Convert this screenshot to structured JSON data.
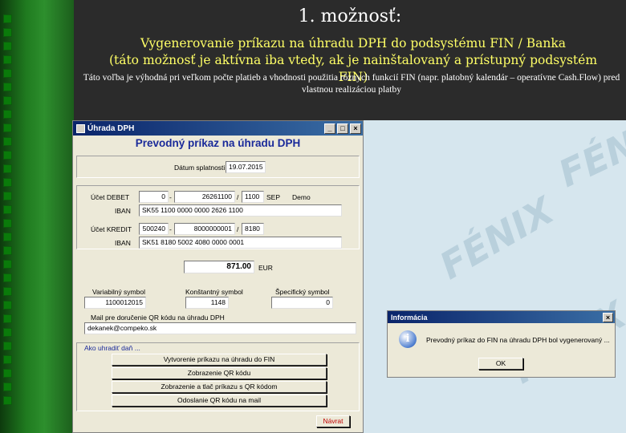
{
  "slide": {
    "title": "1. možnosť:",
    "subtitle_line1": "Vygenerovanie príkazu na úhradu DPH do podsystému FIN / Banka",
    "subtitle_line2": "(táto možnosť je aktívna iba vtedy, ak je nainštalovaný a prístupný podsystém FIN)",
    "description": "Táto voľba je výhodná pri veľkom počte platieb a vhodnosti použitia rôznych funkcií FIN (napr. platobný kalendár – operatívne Cash.Flow) pred vlastnou realizáciou platby"
  },
  "dialog": {
    "title": "Úhrada DPH",
    "heading": "Prevodný príkaz na úhradu DPH",
    "due_date_label": "Dátum splatnosti",
    "due_date": "19.07.2015",
    "debit_label": "Účet DEBET",
    "debit_prefix": "0",
    "debit_account": "26261100",
    "debit_bank": "1100",
    "debit_bank_name": "SEP",
    "debit_note": "Demo",
    "iban_label": "IBAN",
    "debit_iban": "SK55 1100 0000 0000 2626 1100",
    "credit_label": "Účet KREDIT",
    "credit_prefix": "500240",
    "credit_account": "8000000001",
    "credit_bank": "8180",
    "credit_iban": "SK51 8180 5002 4080 0000 0001",
    "amount": "871.00",
    "currency": "EUR",
    "variable_symbol_label": "Variabilný symbol",
    "variable_symbol": "1100012015",
    "constant_symbol_label": "Konštantný symbol",
    "constant_symbol": "1148",
    "specific_symbol_label": "Špecifický symbol",
    "specific_symbol": "0",
    "email_label": "Mail pre doručenie QR kódu na úhradu DPH",
    "email": "dekanek@compeko.sk",
    "how_to_pay_label": "Ako uhradiť daň ...",
    "buttons": {
      "create_order": "Vytvorenie príkazu na úhradu do FIN",
      "show_qr": "Zobrazenie QR kódu",
      "show_print_qr": "Zobrazenie a tlač príkazu s QR kódom",
      "send_qr_mail": "Odoslanie QR kódu na mail",
      "back": "Návrat"
    },
    "title_buttons": {
      "min": "_",
      "max": "□",
      "close": "×"
    }
  },
  "info_dialog": {
    "title": "Informácia",
    "message": "Prevodný príkaz do FIN na úhradu DPH bol vygenerovaný ...",
    "ok": "OK",
    "close": "×"
  },
  "watermark": {
    "logo_text": "FÉNIX"
  },
  "colors": {
    "slide_bg": "#2b2b2b",
    "subtitle": "#ffff66",
    "heading": "#1a2a9a",
    "titlebar": "#0a246a",
    "dialog_bg": "#ece9d8"
  }
}
